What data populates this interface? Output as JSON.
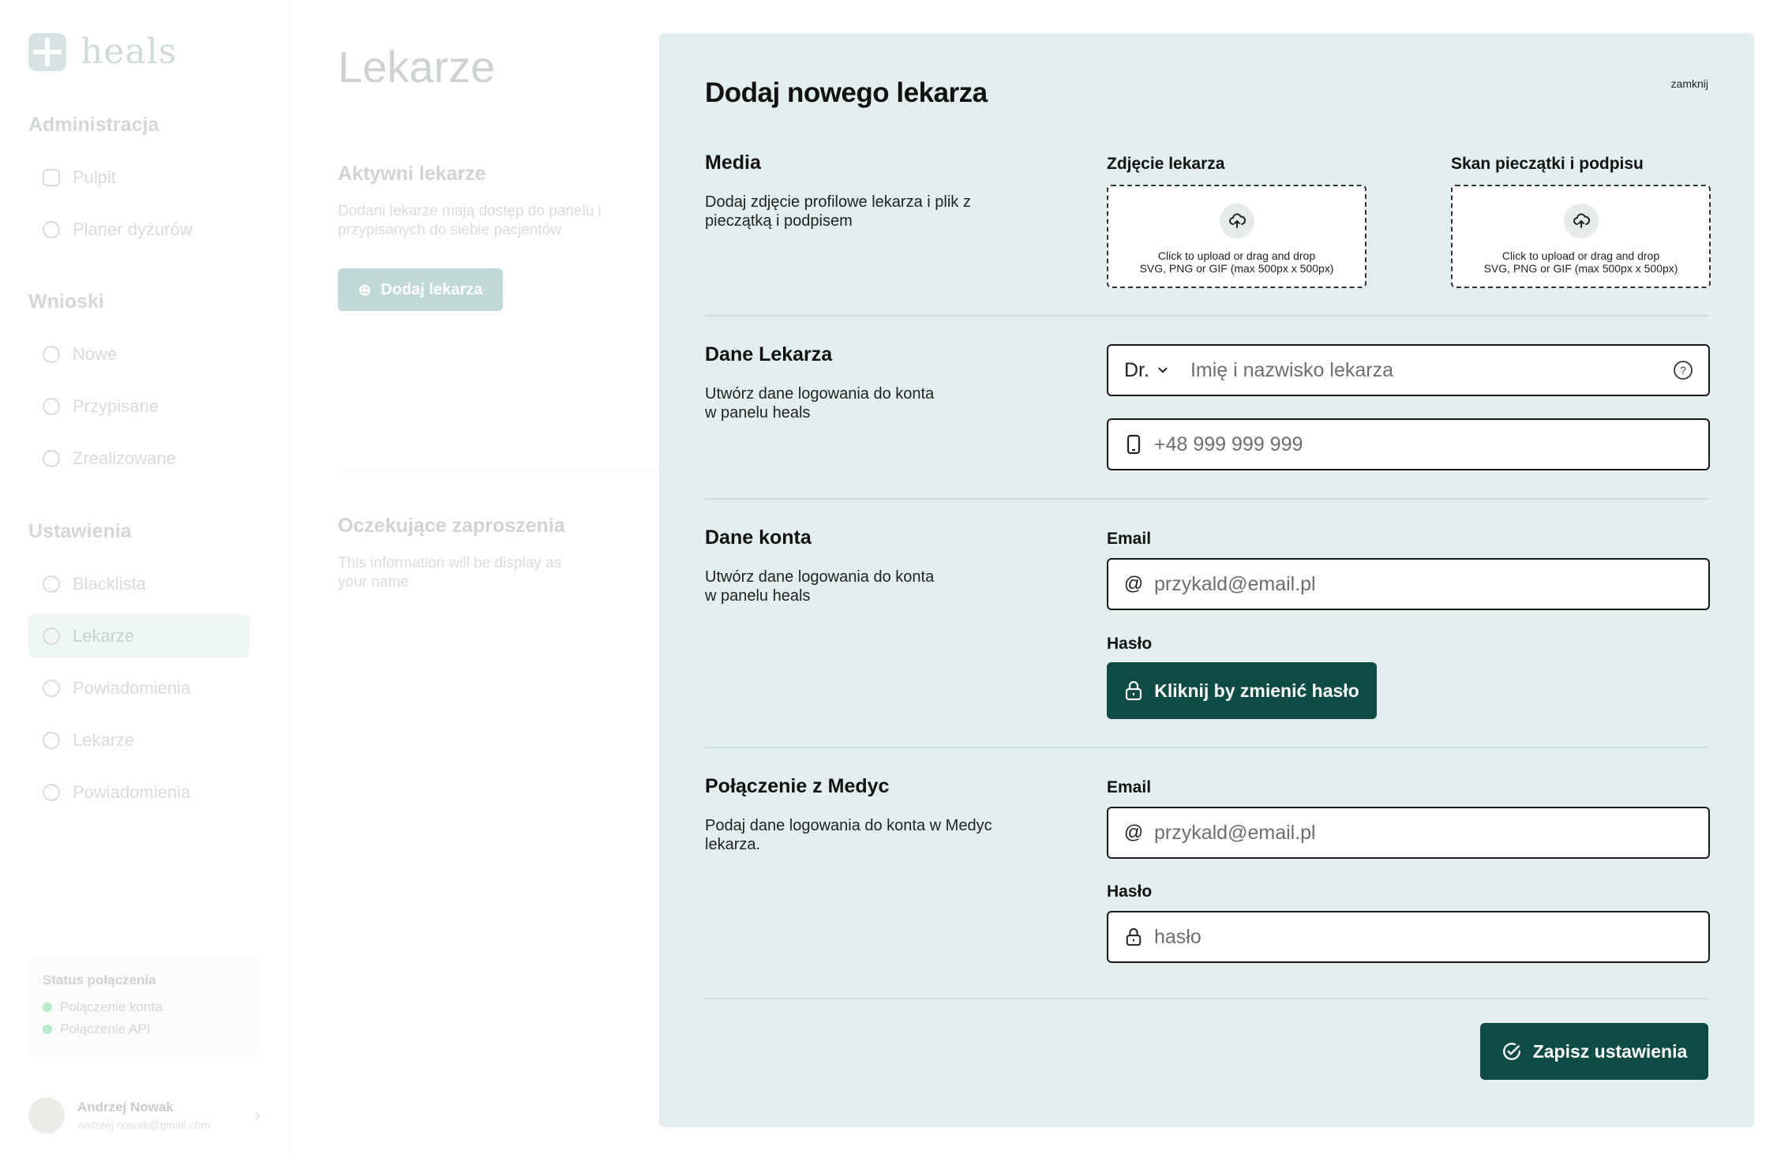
{
  "app": {
    "logo_text": "heals"
  },
  "sidebar": {
    "sections": [
      {
        "title": "Administracja",
        "items": [
          {
            "label": "Pulpit",
            "icon": "dashboard-icon"
          },
          {
            "label": "Planer dyżurów",
            "icon": "clock-icon"
          }
        ]
      },
      {
        "title": "Wnioski",
        "items": [
          {
            "label": "Nowe",
            "icon": "inbox-icon"
          },
          {
            "label": "Przypisane",
            "icon": "assigned-icon"
          },
          {
            "label": "Zrealizowane",
            "icon": "done-icon"
          }
        ]
      },
      {
        "title": "Ustawienia",
        "items": [
          {
            "label": "Blacklista",
            "icon": "block-icon"
          },
          {
            "label": "Lekarze",
            "icon": "users-icon",
            "active": true
          },
          {
            "label": "Powiadomienia",
            "icon": "bell-icon"
          },
          {
            "label": "Lekarze",
            "icon": "users-icon"
          },
          {
            "label": "Powiadomienia",
            "icon": "bell-icon"
          }
        ]
      }
    ],
    "status": {
      "title": "Status połączenia",
      "items": [
        "Połączenie konta",
        "Połączenie API"
      ],
      "color": "#22c55e"
    },
    "user": {
      "name": "Andrzej Nowak",
      "email": "andrzej.nowak@gmail.com"
    }
  },
  "main": {
    "title": "Lekarze",
    "active": {
      "title": "Aktywni lekarze",
      "desc": "Dodani lekarze mają dostęp do panelu i przypisanych do siebie pacjentów",
      "button": "Dodaj lekarza"
    },
    "pending": {
      "title": "Oczekujące zaproszenia",
      "desc": "This information will be display as your name"
    }
  },
  "modal": {
    "title": "Dodaj nowego lekarza",
    "close": "zamknij",
    "media": {
      "title": "Media",
      "desc": "Dodaj zdjęcie profilowe lekarza i plik z pieczątką i podpisem",
      "photo_label": "Zdjęcie lekarza",
      "stamp_label": "Skan pieczątki i podpisu",
      "upload_line1": "Click to upload or drag and drop",
      "upload_line2": "SVG, PNG or GIF (max 500px x 500px)"
    },
    "doctor": {
      "title": "Dane Lekarza",
      "desc": "Utwórz dane logowania do konta w panelu heals",
      "prefix": "Dr.",
      "name_placeholder": "Imię i nazwisko lekarza",
      "phone_placeholder": "+48 999 999 999"
    },
    "account": {
      "title": "Dane konta",
      "desc": "Utwórz dane logowania do konta w panelu heals",
      "email_label": "Email",
      "email_placeholder": "przykald@email.pl",
      "password_label": "Hasło",
      "password_button": "Kliknij by zmienić hasło"
    },
    "medyc": {
      "title": "Połączenie z Medyc",
      "desc": "Podaj dane logowania do konta w Medyc lekarza.",
      "email_label": "Email",
      "email_placeholder": "przykald@email.pl",
      "password_label": "Hasło",
      "password_placeholder": "hasło"
    },
    "save": "Zapisz ustawienia",
    "accent_color": "#0d4b45",
    "panel_color": "#e2efee"
  }
}
